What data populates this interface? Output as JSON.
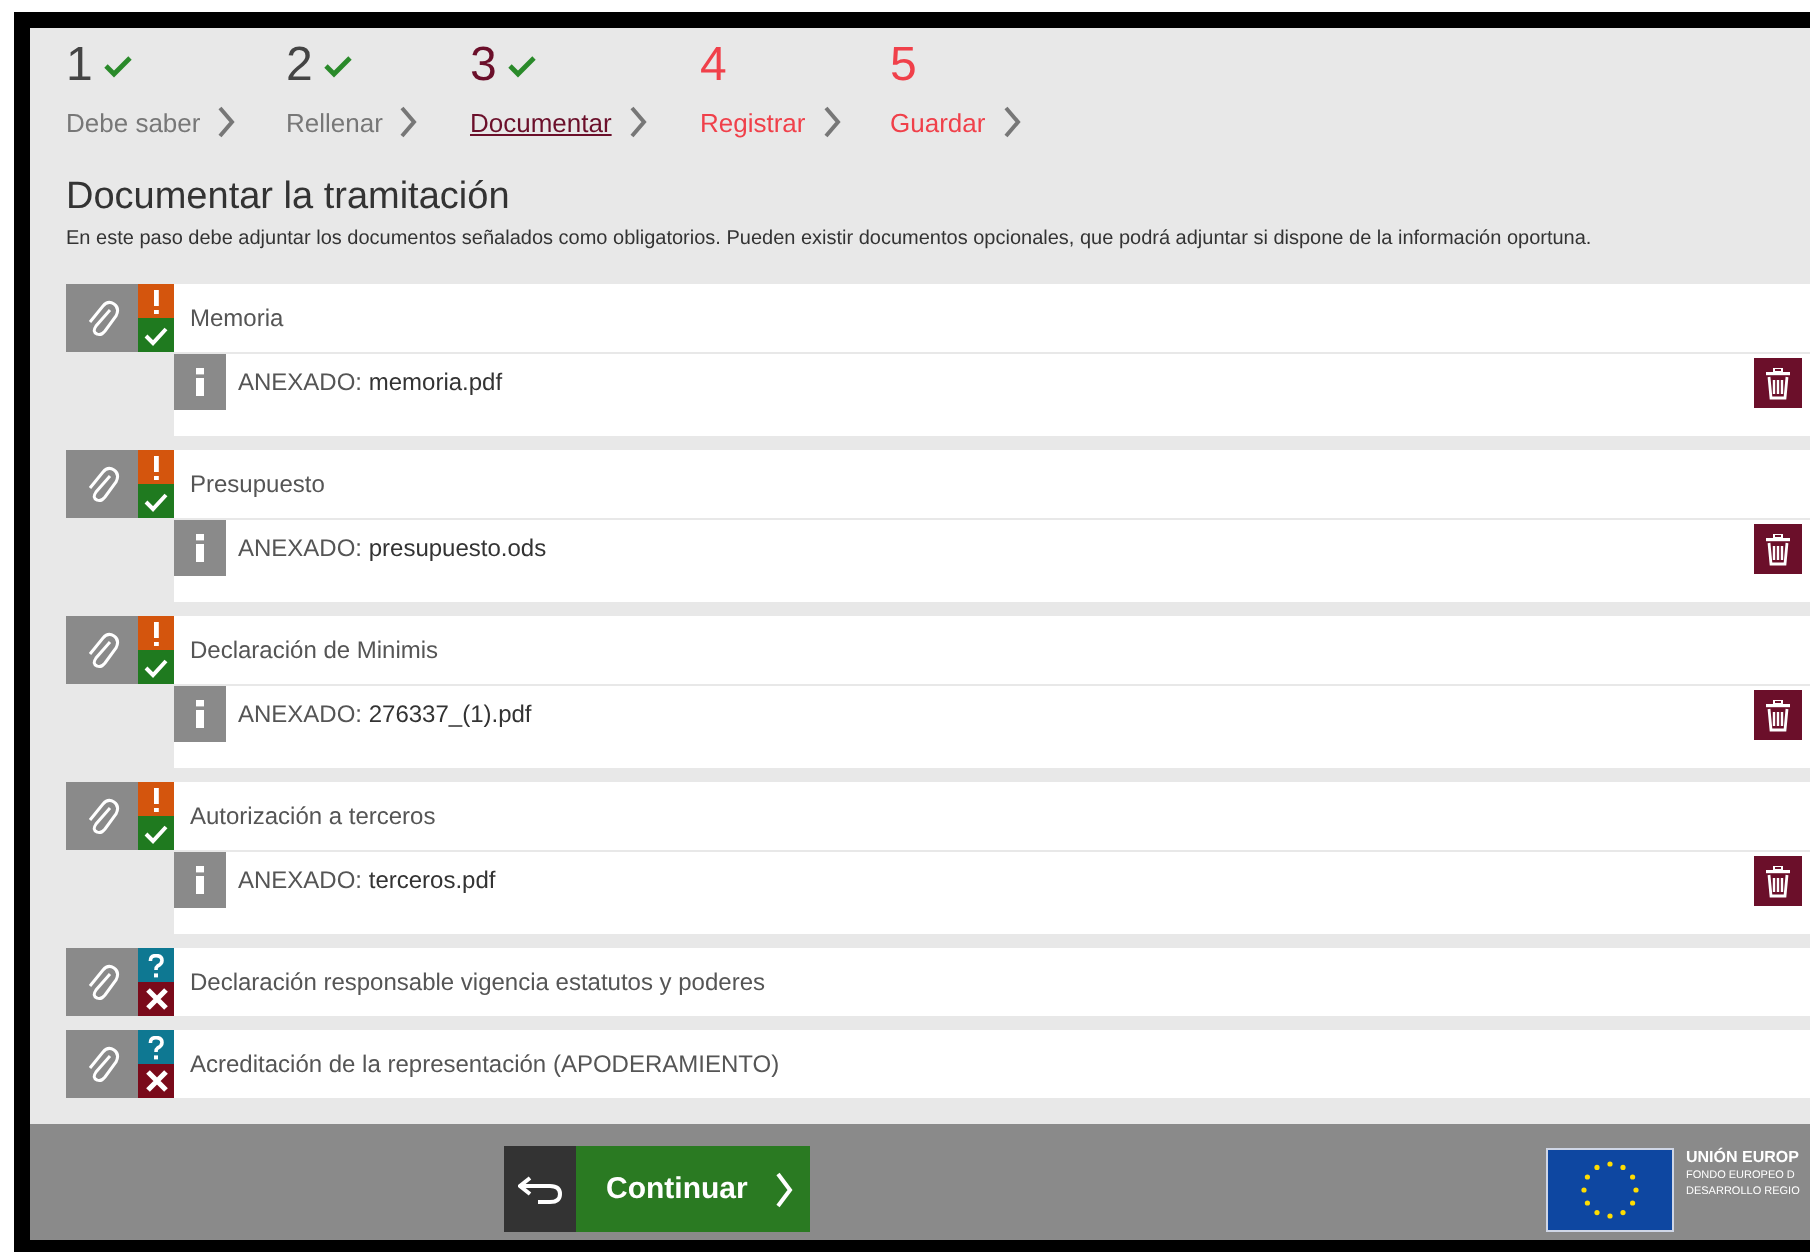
{
  "steps": [
    {
      "number": "1",
      "label": "Debe saber",
      "checked": true,
      "kind": "done"
    },
    {
      "number": "2",
      "label": "Rellenar",
      "checked": true,
      "kind": "done"
    },
    {
      "number": "3",
      "label": "Documentar",
      "checked": true,
      "kind": "current"
    },
    {
      "number": "4",
      "label": "Registrar",
      "checked": false,
      "kind": "pending"
    },
    {
      "number": "5",
      "label": "Guardar",
      "checked": false,
      "kind": "pending"
    }
  ],
  "title": "Documentar la tramitación",
  "description": "En este paso debe adjuntar los documentos señalados como obligatorios. Pueden existir documentos opcionales, que podrá adjuntar si dispone de la información oportuna.",
  "documents": [
    {
      "name": "Memoria",
      "required": true,
      "attached": true,
      "attachment": {
        "prefix": "ANEXADO:",
        "file": "memoria.pdf"
      }
    },
    {
      "name": "Presupuesto",
      "required": true,
      "attached": true,
      "attachment": {
        "prefix": "ANEXADO:",
        "file": "presupuesto.ods"
      }
    },
    {
      "name": "Declaración de Minimis",
      "required": true,
      "attached": true,
      "attachment": {
        "prefix": "ANEXADO:",
        "file": "276337_(1).pdf"
      }
    },
    {
      "name": "Autorización a terceros",
      "required": true,
      "attached": true,
      "attachment": {
        "prefix": "ANEXADO:",
        "file": "terceros.pdf"
      }
    },
    {
      "name": "Declaración responsable vigencia estatutos y poderes",
      "required": false,
      "attached": false
    },
    {
      "name": "Acreditación de la representación (APODERAMIENTO)",
      "required": false,
      "attached": false
    }
  ],
  "footer": {
    "continue_label": "Continuar",
    "eu_logo": {
      "title": "UNIÓN EUROP",
      "line_1": "FONDO EUROPEO D",
      "line_2": "DESARROLLO REGIO"
    }
  }
}
